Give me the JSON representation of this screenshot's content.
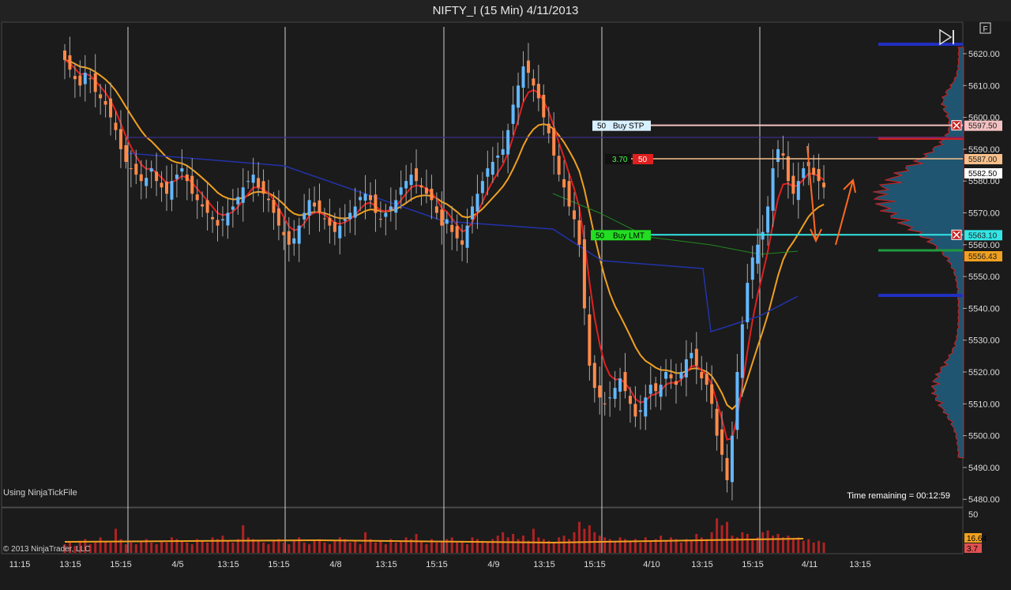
{
  "window": {
    "title": "NIFTY_I (15 Min)  4/11/2013"
  },
  "panel": {
    "f_button": "F"
  },
  "chart_data": {
    "type": "candlestick",
    "instrument": "NIFTY_I",
    "interval": "15 Min",
    "date": "4/11/2013",
    "price_axis": {
      "ticks": [
        5620,
        5610,
        5600,
        5590,
        5580,
        5570,
        5560,
        5550,
        5540,
        5530,
        5520,
        5510,
        5500,
        5490,
        5480
      ],
      "tick_labels": [
        "5620.00",
        "5610.00",
        "5600.00",
        "5590.00",
        "5580.00",
        "5570.00",
        "5560.00",
        "5550.00",
        "5540.00",
        "5530.00",
        "5520.00",
        "5510.00",
        "5500.00",
        "5490.00",
        "5480.00"
      ],
      "ylim": [
        5478,
        5632
      ]
    },
    "time_axis": {
      "labels": [
        "11:15",
        "13:15",
        "15:15",
        "4/5",
        "13:15",
        "15:15",
        "4/8",
        "13:15",
        "15:15",
        "4/9",
        "13:15",
        "15:15",
        "4/10",
        "13:15",
        "15:15",
        "4/11",
        "13:15"
      ],
      "session_boundaries": [
        "4/5",
        "4/8",
        "4/9",
        "4/10",
        "4/11"
      ]
    },
    "volume_axis": {
      "ticks": [
        50
      ],
      "tick_labels": [
        "50"
      ]
    },
    "price_markers": [
      {
        "label": "5597.50",
        "value": 5597.5,
        "color": "#f4c2c2"
      },
      {
        "label": "5587.00",
        "value": 5587.0,
        "color": "#f7c08c"
      },
      {
        "label": "5582.50",
        "value": 5582.5,
        "color": "#ffffff"
      },
      {
        "label": "5563.10",
        "value": 5563.1,
        "color": "#33e6e6"
      },
      {
        "label": "5556.43",
        "value": 5556.43,
        "color": "#f0a020"
      }
    ],
    "volume_markers": [
      {
        "label": "16.64",
        "color": "#f0a020"
      },
      {
        "label": "3.7",
        "color": "#e05050"
      }
    ],
    "orders": [
      {
        "qty": "50",
        "type": "Buy STP",
        "price": 5597.5
      },
      {
        "qty": "50",
        "type": "Buy LMT",
        "price": 5563.1
      }
    ],
    "position": {
      "pnl": "3.70",
      "qty": "50",
      "price": 5587.0
    },
    "closes": [
      5618,
      5615,
      5612,
      5610,
      5614,
      5612,
      5608,
      5606,
      5604,
      5600,
      5596,
      5590,
      5586,
      5584,
      5582,
      5580,
      5581,
      5584,
      5580,
      5578,
      5576,
      5580,
      5582,
      5584,
      5580,
      5576,
      5574,
      5572,
      5570,
      5568,
      5566,
      5568,
      5570,
      5572,
      5575,
      5578,
      5580,
      5582,
      5578,
      5576,
      5574,
      5570,
      5566,
      5563,
      5560,
      5562,
      5566,
      5570,
      5574,
      5572,
      5570,
      5568,
      5566,
      5564,
      5566,
      5568,
      5570,
      5572,
      5575,
      5576,
      5574,
      5570,
      5568,
      5570,
      5572,
      5574,
      5578,
      5580,
      5582,
      5580,
      5578,
      5576,
      5574,
      5570,
      5566,
      5568,
      5564,
      5562,
      5560,
      5566,
      5572,
      5576,
      5580,
      5584,
      5586,
      5588,
      5590,
      5596,
      5604,
      5610,
      5616,
      5614,
      5610,
      5606,
      5600,
      5595,
      5588,
      5582,
      5578,
      5572,
      5568,
      5560,
      5540,
      5522,
      5515,
      5512,
      5510,
      5512,
      5515,
      5518,
      5514,
      5510,
      5506,
      5508,
      5512,
      5516,
      5514,
      5516,
      5520,
      5518,
      5516,
      5520,
      5524,
      5526,
      5522,
      5518,
      5516,
      5510,
      5500,
      5494,
      5486,
      5500,
      5520,
      5535,
      5548,
      5556,
      5560,
      5564,
      5572,
      5584,
      5590,
      5588,
      5580,
      5576,
      5580,
      5584,
      5586,
      5582,
      5580,
      5578
    ],
    "volumes": [
      5,
      6,
      4,
      7,
      8,
      5,
      6,
      9,
      7,
      6,
      14,
      8,
      5,
      6,
      5,
      7,
      8,
      6,
      5,
      7,
      6,
      9,
      8,
      7,
      6,
      5,
      8,
      7,
      6,
      9,
      8,
      10,
      7,
      6,
      8,
      16,
      9,
      8,
      7,
      6,
      5,
      7,
      8,
      6,
      5,
      7,
      9,
      6,
      5,
      7,
      8,
      6,
      5,
      7,
      9,
      8,
      6,
      7,
      5,
      12,
      8,
      6,
      7,
      5,
      8,
      6,
      7,
      9,
      8,
      11,
      7,
      5,
      8,
      6,
      7,
      8,
      9,
      6,
      7,
      5,
      9,
      8,
      7,
      6,
      8,
      10,
      12,
      9,
      11,
      8,
      10,
      7,
      14,
      9,
      8,
      7,
      6,
      9,
      10,
      8,
      12,
      18,
      14,
      16,
      12,
      10,
      9,
      8,
      7,
      9,
      8,
      7,
      8,
      6,
      9,
      7,
      8,
      10,
      7,
      9,
      8,
      6,
      8,
      7,
      11,
      9,
      8,
      12,
      20,
      16,
      18,
      10,
      9,
      12,
      11,
      8,
      9,
      12,
      13,
      10,
      11,
      9,
      10,
      8,
      9,
      7,
      8,
      6,
      7,
      6
    ],
    "studies": [
      {
        "name": "EMA fast",
        "color": "#e02020"
      },
      {
        "name": "EMA slow",
        "color": "#f0a020"
      },
      {
        "name": "VWAP",
        "color": "#2233aa"
      },
      {
        "name": "Average",
        "color": "#1f8a1f"
      },
      {
        "name": "Volume profile",
        "color": "#1c5a78"
      }
    ]
  },
  "footer": {
    "data_source": "Using NinjaTickFile",
    "time_remaining": "Time remaining = 00:12:59",
    "copyright": "© 2013 NinjaTrader, LLC"
  }
}
